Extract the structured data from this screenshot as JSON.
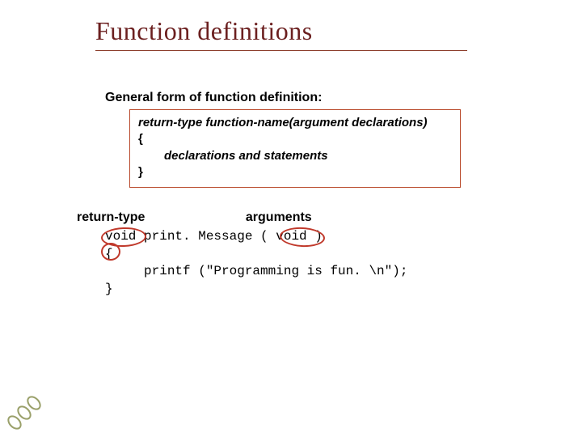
{
  "title": "Function definitions",
  "subhead": "General form of  function definition:",
  "defbox": {
    "sig": "return-type  function-name(argument declarations)",
    "open": "{",
    "body": "declarations  and statements",
    "close": "}"
  },
  "labels": {
    "return": "return-type",
    "args": "arguments"
  },
  "code": {
    "line1": "void print. Message ( void )",
    "line2": "{",
    "line3": "     printf (\"Programming is fun. \\n\");",
    "line4": "}"
  }
}
